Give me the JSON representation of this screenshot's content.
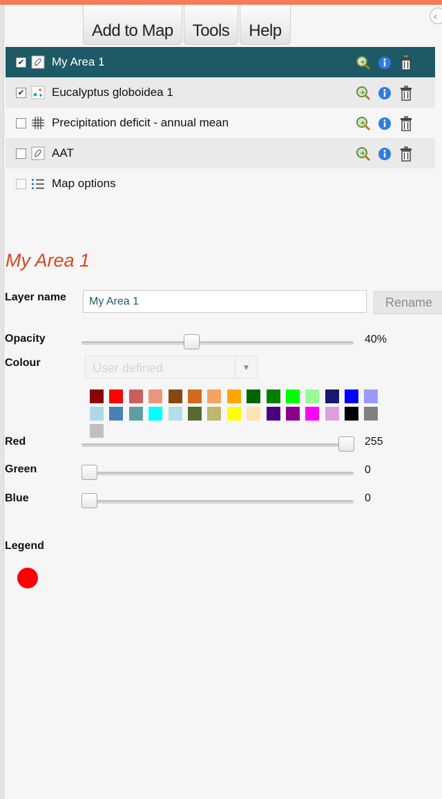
{
  "menu": [
    "Add to Map",
    "Tools",
    "Help"
  ],
  "collapse_icon": "chevron-left-icon",
  "layers": [
    {
      "label": "My Area 1",
      "checked": true,
      "icon": "area-polygon-icon",
      "selected": true
    },
    {
      "label": "Eucalyptus globoidea 1",
      "checked": true,
      "icon": "points-icon",
      "selected": false
    },
    {
      "label": "Precipitation deficit - annual mean",
      "checked": false,
      "icon": "grid-icon",
      "selected": false
    },
    {
      "label": "AAT",
      "checked": false,
      "icon": "area-polygon-icon",
      "selected": false
    }
  ],
  "map_options": {
    "label": "Map options",
    "icon": "list-icon"
  },
  "row_action_icons": [
    "zoom-to-layer-icon",
    "info-icon",
    "trash-icon"
  ],
  "details": {
    "title": "My Area 1",
    "layer_name_label": "Layer name",
    "layer_name_value": "My Area 1",
    "rename_label": "Rename",
    "opacity_label": "Opacity",
    "opacity_percent": 40,
    "opacity_value": "40%",
    "colour_label": "Colour",
    "colour_select": "User defined",
    "red_label": "Red",
    "red_value": "255",
    "green_label": "Green",
    "green_value": "0",
    "blue_label": "Blue",
    "blue_value": "0",
    "legend_label": "Legend",
    "legend_color": "#ff0000"
  },
  "palette": [
    "#8b0000",
    "#ff0000",
    "#cd5c5c",
    "#e9967a",
    "#8b4513",
    "#d2691e",
    "#f4a460",
    "#ffa500",
    "#006400",
    "#008000",
    "#00ff00",
    "#98fb98",
    "#191970",
    "#0000ff",
    "#9999ff",
    "#add8e6",
    "#4682b4",
    "#5f9ea0",
    "#00ffff",
    "#b0e0e6",
    "#556b2f",
    "#bdb76b",
    "#ffff00",
    "#ffe4b5",
    "#4b0082",
    "#8b008b",
    "#ff00ff",
    "#dda0dd",
    "#000000",
    "#808080",
    "#c0c0c0"
  ],
  "colors": {
    "accent": "#f47b5b",
    "selected_row": "#1d5a65",
    "title": "#e0421d"
  }
}
